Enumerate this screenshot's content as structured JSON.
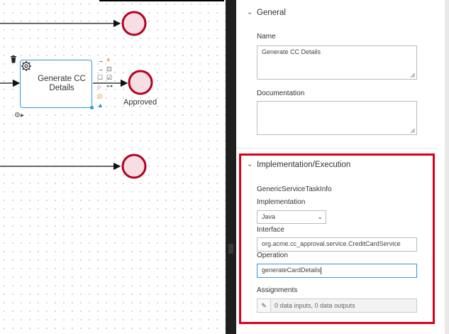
{
  "canvas": {
    "task": {
      "label": "Generate CC Details"
    },
    "end_label": "Approved"
  },
  "panel": {
    "general": {
      "title": "General",
      "name_label": "Name",
      "name_value": "Generate CC Details",
      "documentation_label": "Documentation",
      "documentation_value": ""
    },
    "implementation": {
      "title": "Implementation/Execution",
      "info_label": "GenericServiceTaskInfo",
      "implementation_label": "Implementation",
      "implementation_value": "Java",
      "interface_label": "Interface",
      "interface_value": "org.acme.cc_approval.service.CreditCardService",
      "operation_label": "Operation",
      "operation_value": "generateCardDetails",
      "assignments_label": "Assignments",
      "assignments_value": "0 data inputs, 0 data outputs"
    }
  },
  "colors": {
    "end_event_stroke": "#b5001f",
    "end_event_fill": "#f6dfe2",
    "task_border": "#2e9ad1",
    "highlight": "#d9001b"
  },
  "icons": [
    "delete-icon",
    "gear-icon",
    "settings-menu-icon",
    "chevron-down-icon",
    "edit-icon"
  ]
}
